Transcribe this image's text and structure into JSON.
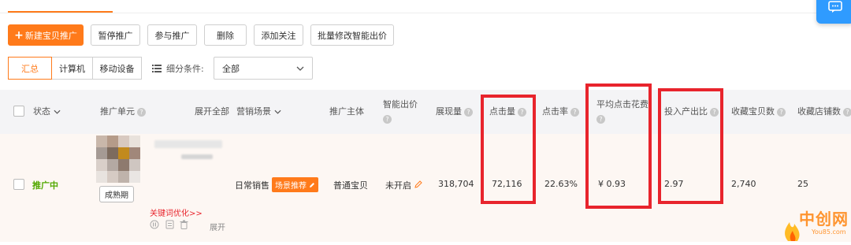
{
  "toolbar": {
    "new_label": "新建宝贝推广",
    "pause_label": "暂停推广",
    "join_label": "参与推广",
    "delete_label": "删除",
    "follow_label": "添加关注",
    "batch_label": "批量修改智能出价"
  },
  "device_tabs": [
    "汇总",
    "计算机",
    "移动设备"
  ],
  "filter": {
    "label": "细分条件:",
    "value": "全部"
  },
  "columns": {
    "status": "状态",
    "unit": "推广单元",
    "expand_all": "展开全部",
    "scene": "营销场景",
    "subject": "推广主体",
    "smart_bid_1": "智能出价",
    "impressions": "展现量",
    "clicks": "点击量",
    "ctr": "点击率",
    "avg_cpc_1": "平均点击花费",
    "roi": "投入产出比",
    "fav_items": "收藏宝贝数",
    "fav_shops": "收藏店铺数"
  },
  "row": {
    "status": "推广中",
    "stage_button": "成熟期",
    "keyword_link": "关键词优化>>",
    "expand": "展开",
    "scene": "日常销售",
    "scene_tag": "场景推荐",
    "subject": "普通宝贝",
    "smart_bid": "未开启",
    "impressions": "318,704",
    "clicks": "72,116",
    "ctr": "22.63%",
    "avg_cpc": "¥ 0.93",
    "roi": "2.97",
    "fav_items": "2,740",
    "fav_shops": "25"
  },
  "watermark": {
    "text": "中创网",
    "site": "You85.com"
  },
  "colors": {
    "accent": "#ff7a1a",
    "highlight_box": "#e8242c",
    "status_green": "#52a800",
    "chat_blue": "#2f9bff"
  }
}
